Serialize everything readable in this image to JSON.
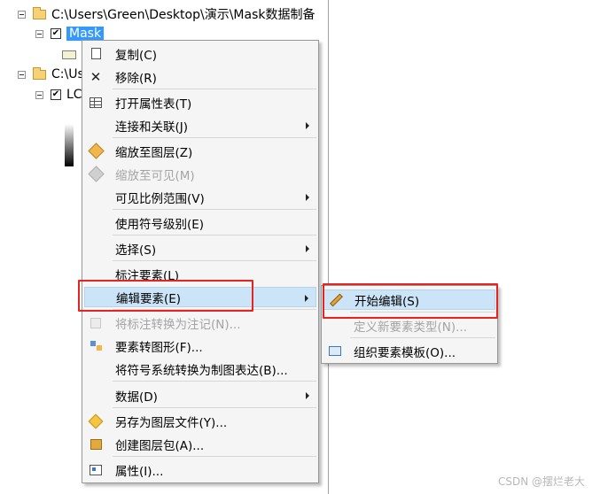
{
  "tree": {
    "folder1_path": "C:\\Users\\Green\\Desktop\\演示\\Mask数据制备",
    "layer1_name": "Mask",
    "folder2_path": "C:\\Us",
    "layer2_name": "LC",
    "layer1_checked": "✔",
    "layer2_checked": "✔"
  },
  "context_menu": {
    "items": [
      {
        "label": "复制(C)",
        "icon": "copy-icon",
        "enabled": true
      },
      {
        "label": "移除(R)",
        "icon": "remove-icon",
        "enabled": true
      },
      {
        "label": "打开属性表(T)",
        "icon": "attribute-table-icon",
        "enabled": true
      },
      {
        "label": "连接和关联(J)",
        "icon": "",
        "enabled": true,
        "submenu": true
      },
      {
        "label": "缩放至图层(Z)",
        "icon": "zoom-to-layer-icon",
        "enabled": true
      },
      {
        "label": "缩放至可见(M)",
        "icon": "zoom-to-visible-icon",
        "enabled": false
      },
      {
        "label": "可见比例范围(V)",
        "icon": "",
        "enabled": true,
        "submenu": true
      },
      {
        "label": "使用符号级别(E)",
        "icon": "",
        "enabled": true
      },
      {
        "label": "选择(S)",
        "icon": "",
        "enabled": true,
        "submenu": true
      },
      {
        "label": "标注要素(L)",
        "icon": "",
        "enabled": true
      },
      {
        "label": "编辑要素(E)",
        "icon": "",
        "enabled": true,
        "submenu": true,
        "highlighted": true
      },
      {
        "label": "将标注转换为注记(N)...",
        "icon": "convert-labels-icon",
        "enabled": false
      },
      {
        "label": "要素转图形(F)...",
        "icon": "features-to-graphics-icon",
        "enabled": true
      },
      {
        "label": "将符号系统转换为制图表达(B)...",
        "icon": "",
        "enabled": true
      },
      {
        "label": "数据(D)",
        "icon": "",
        "enabled": true,
        "submenu": true
      },
      {
        "label": "另存为图层文件(Y)...",
        "icon": "layer-file-icon",
        "enabled": true
      },
      {
        "label": "创建图层包(A)...",
        "icon": "layer-package-icon",
        "enabled": true
      },
      {
        "label": "属性(I)...",
        "icon": "properties-icon",
        "enabled": true
      }
    ]
  },
  "submenu": {
    "items": [
      {
        "label": "开始编辑(S)",
        "icon": "start-editing-icon",
        "enabled": true,
        "highlighted": true
      },
      {
        "label": "定义新要素类型(N)...",
        "icon": "",
        "enabled": false
      },
      {
        "label": "组织要素模板(O)...",
        "icon": "organize-templates-icon",
        "enabled": true
      }
    ]
  },
  "watermark": "CSDN @摆烂老大",
  "colors": {
    "selection": "#3399ff",
    "hover": "#cce4f7",
    "annotation_box": "#e8231f"
  }
}
